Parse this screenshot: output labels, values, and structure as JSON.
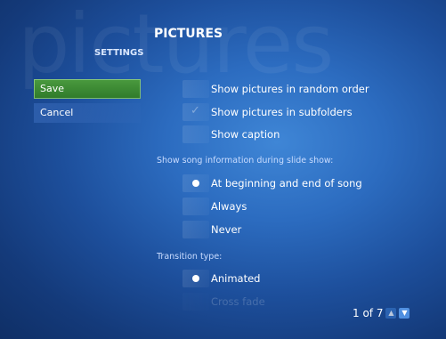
{
  "header": {
    "watermark": "pictures",
    "title": "PICTURES",
    "section": "SETTINGS"
  },
  "sidebar": {
    "save_label": "Save",
    "cancel_label": "Cancel"
  },
  "options": {
    "random_order": {
      "label": "Show pictures in random order",
      "checked": false
    },
    "subfolders": {
      "label": "Show pictures in subfolders",
      "checked": true
    },
    "caption": {
      "label": "Show caption",
      "checked": false
    }
  },
  "song_info": {
    "label": "Show song information during slide show:",
    "choices": [
      "At beginning and end of song",
      "Always",
      "Never"
    ],
    "selected": "At beginning and end of song"
  },
  "transition": {
    "label": "Transition type:",
    "choices": [
      "Animated",
      "Cross fade"
    ],
    "selected": "Animated"
  },
  "pager": {
    "text": "1 of 7",
    "up_icon": "chevron-up-icon",
    "down_icon": "chevron-down-icon"
  }
}
